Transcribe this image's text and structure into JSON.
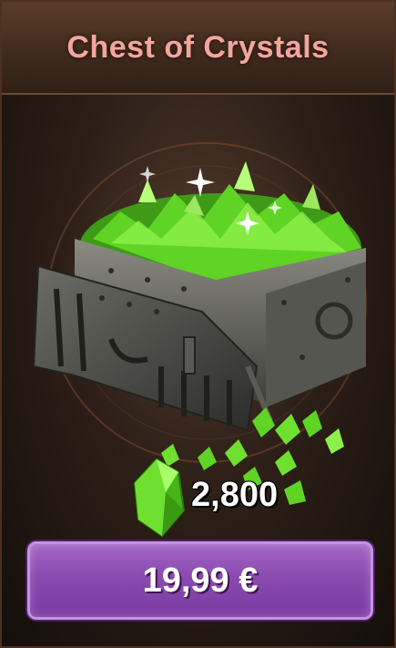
{
  "card": {
    "title": "Chest of Crystals",
    "amount": "2,800",
    "price": "19,99 €"
  },
  "icons": {
    "art": "crystal-chest-icon",
    "currency": "green-crystal-icon"
  },
  "colors": {
    "title": "#f2a69b",
    "button": "#8a4aaf",
    "crystal": "#5fd424"
  }
}
